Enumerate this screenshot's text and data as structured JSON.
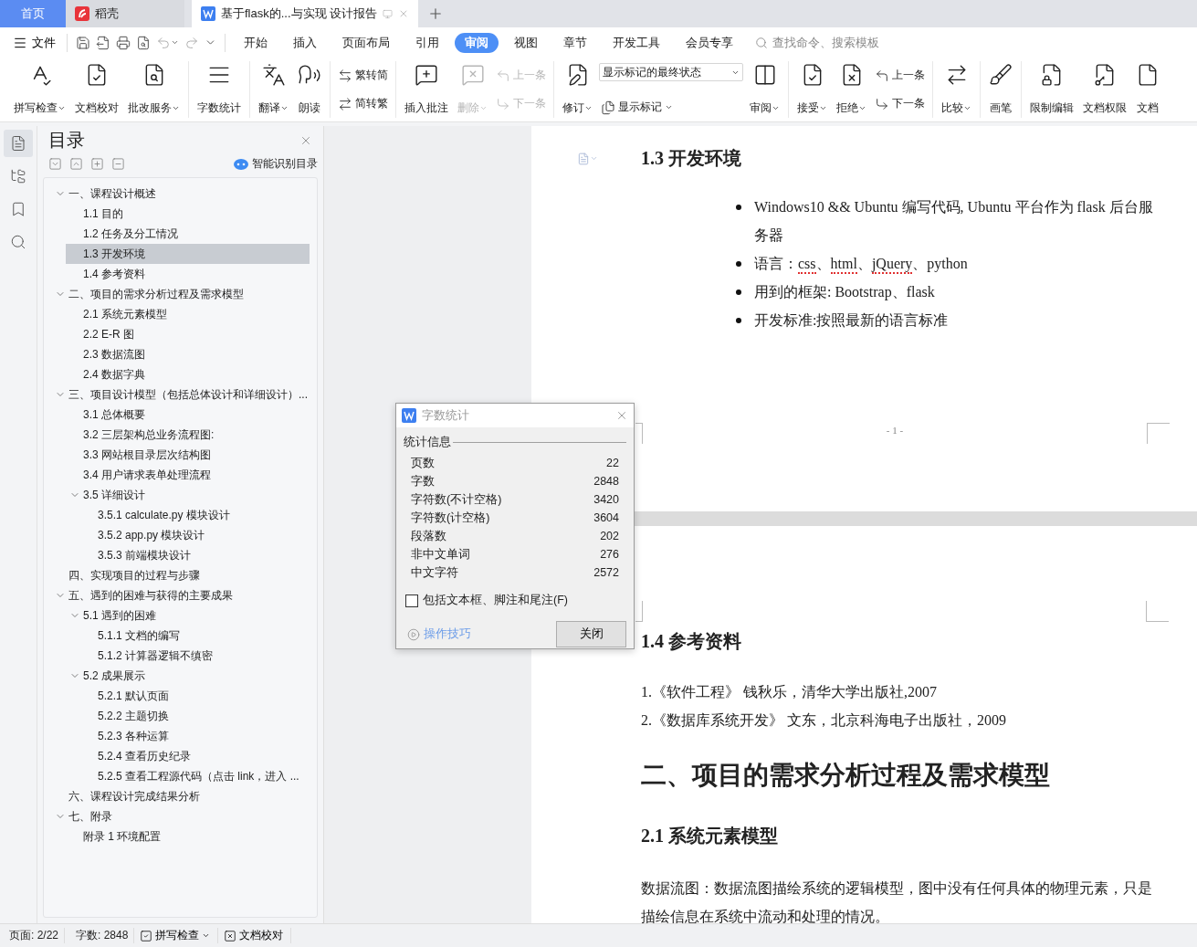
{
  "tabs": [
    {
      "kind": "home",
      "label": "首页",
      "selected": false
    },
    {
      "kind": "docer",
      "label": "稻壳",
      "selected": false
    },
    {
      "kind": "document",
      "label": "基于flask的...与实现 设计报告",
      "selected": true
    }
  ],
  "menu": {
    "file": "文件",
    "items": [
      {
        "label": "开始",
        "selected": false
      },
      {
        "label": "插入",
        "selected": false
      },
      {
        "label": "页面布局",
        "selected": false
      },
      {
        "label": "引用",
        "selected": false
      },
      {
        "label": "审阅",
        "selected": true
      },
      {
        "label": "视图",
        "selected": false
      },
      {
        "label": "章节",
        "selected": false
      },
      {
        "label": "开发工具",
        "selected": false
      },
      {
        "label": "会员专享",
        "selected": false
      }
    ],
    "search": {
      "placeholder": "查找命令、搜索模板"
    }
  },
  "ribbon": [
    {
      "tools": [
        {
          "kind": "large",
          "label": "拼写检查",
          "dropdown": true,
          "disabled": false
        },
        {
          "kind": "large",
          "label": "文档校对",
          "dropdown": false,
          "disabled": false
        },
        {
          "kind": "large",
          "label": "批改服务",
          "dropdown": true,
          "disabled": false
        }
      ]
    },
    {
      "tools": [
        {
          "kind": "large",
          "label": "字数统计",
          "dropdown": false,
          "disabled": false
        }
      ]
    },
    {
      "tools": [
        {
          "kind": "large",
          "label": "翻译",
          "dropdown": true,
          "disabled": false
        },
        {
          "kind": "large",
          "label": "朗读",
          "dropdown": false,
          "disabled": false
        }
      ]
    },
    {
      "tools": [
        {
          "kind": "stack",
          "items": [
            {
              "label": "繁转简",
              "disabled": false
            },
            {
              "label": "简转繁",
              "disabled": false
            }
          ]
        }
      ]
    },
    {
      "tools": [
        {
          "kind": "large",
          "label": "插入批注",
          "dropdown": false,
          "disabled": false
        },
        {
          "kind": "large",
          "label": "删除",
          "dropdown": true,
          "disabled": true
        },
        {
          "kind": "stack",
          "items": [
            {
              "label": "上一条",
              "disabled": true
            },
            {
              "label": "下一条",
              "disabled": true
            }
          ]
        }
      ]
    },
    {
      "tools": [
        {
          "kind": "large",
          "label": "修订",
          "dropdown": true,
          "disabled": false
        },
        {
          "kind": "markup",
          "value": "显示标记的最终状态",
          "option": "显示标记"
        },
        {
          "kind": "large",
          "label": "审阅",
          "dropdown": true,
          "disabled": false
        }
      ]
    },
    {
      "tools": [
        {
          "kind": "large",
          "label": "接受",
          "dropdown": true,
          "disabled": false
        },
        {
          "kind": "large",
          "label": "拒绝",
          "dropdown": true,
          "disabled": false
        },
        {
          "kind": "stack",
          "items": [
            {
              "label": "上一条",
              "disabled": false
            },
            {
              "label": "下一条",
              "disabled": false
            }
          ]
        }
      ]
    },
    {
      "tools": [
        {
          "kind": "large",
          "label": "比较",
          "dropdown": true,
          "disabled": false
        }
      ]
    },
    {
      "tools": [
        {
          "kind": "large",
          "label": "画笔",
          "dropdown": false,
          "disabled": false
        }
      ]
    },
    {
      "tools": [
        {
          "kind": "large",
          "label": "限制编辑",
          "dropdown": false,
          "disabled": false
        },
        {
          "kind": "large",
          "label": "文档权限",
          "dropdown": false,
          "disabled": false
        },
        {
          "kind": "large",
          "label": "文档",
          "dropdown": false,
          "disabled": false
        }
      ]
    }
  ],
  "rail": [
    {
      "selected": true
    },
    {
      "selected": false
    },
    {
      "selected": false
    },
    {
      "selected": false
    }
  ],
  "toc": {
    "title": "目录",
    "smart": "智能识别目录",
    "items": [
      {
        "label": "一、课程设计概述",
        "selected": false,
        "expanded": true,
        "children": [
          {
            "label": "1.1 目的",
            "selected": false
          },
          {
            "label": "1.2  任务及分工情况",
            "selected": false
          },
          {
            "label": "1.3 开发环境",
            "selected": true
          },
          {
            "label": "1.4  参考资料",
            "selected": false
          }
        ]
      },
      {
        "label": "二、项目的需求分析过程及需求模型",
        "selected": false,
        "expanded": true,
        "children": [
          {
            "label": "2.1 系统元素模型",
            "selected": false
          },
          {
            "label": "2.2 E-R 图",
            "selected": false
          },
          {
            "label": "2.3 数据流图",
            "selected": false
          },
          {
            "label": "2.4 数据字典",
            "selected": false
          }
        ]
      },
      {
        "label": "三、项目设计模型（包括总体设计和详细设计）...",
        "selected": false,
        "expanded": true,
        "children": [
          {
            "label": "3.1 总体概要",
            "selected": false
          },
          {
            "label": "3.2  三层架构总业务流程图:",
            "selected": false
          },
          {
            "label": "3.3  网站根目录层次结构图",
            "selected": false
          },
          {
            "label": "3.4  用户请求表单处理流程",
            "selected": false
          },
          {
            "label": "3.5  详细设计",
            "selected": false,
            "expanded": true,
            "children": [
              {
                "label": "3.5.1 calculate.py 模块设计",
                "selected": false
              },
              {
                "label": "3.5.2 app.py 模块设计",
                "selected": false
              },
              {
                "label": "3.5.3 前端模块设计",
                "selected": false
              }
            ]
          }
        ]
      },
      {
        "label": "四、实现项目的过程与步骤",
        "selected": false
      },
      {
        "label": "五、遇到的困难与获得的主要成果",
        "selected": false,
        "expanded": true,
        "children": [
          {
            "label": "5.1 遇到的困难",
            "selected": false,
            "expanded": true,
            "children": [
              {
                "label": "5.1.1  文档的编写",
                "selected": false
              },
              {
                "label": "5.1.2  计算器逻辑不缜密",
                "selected": false
              }
            ]
          },
          {
            "label": "5.2  成果展示",
            "selected": false,
            "expanded": true,
            "children": [
              {
                "label": "5.2.1 默认页面",
                "selected": false
              },
              {
                "label": "5.2.2 主题切换",
                "selected": false
              },
              {
                "label": "5.2.3  各种运算",
                "selected": false
              },
              {
                "label": "5.2.4 查看历史纪录",
                "selected": false
              },
              {
                "label": "5.2.5 查看工程源代码（点击 link，进入 ...",
                "selected": false
              }
            ]
          }
        ]
      },
      {
        "label": "六、课程设计完成结果分析",
        "selected": false
      },
      {
        "label": "七、附录",
        "selected": false,
        "expanded": true,
        "children": [
          {
            "label": "附录 1 环境配置",
            "selected": false
          }
        ]
      }
    ]
  },
  "page1": {
    "heading": "1.3 开发环境",
    "bullets": [
      {
        "segments": [
          {
            "text": "Windows10 && Ubuntu 编写代码, Ubuntu 平台作为 flask 后台服务器",
            "misspelled": false
          }
        ]
      },
      {
        "segments": [
          {
            "text": "语言：",
            "misspelled": false
          },
          {
            "text": "css",
            "misspelled": true
          },
          {
            "text": "、",
            "misspelled": false
          },
          {
            "text": "html",
            "misspelled": true
          },
          {
            "text": "、",
            "misspelled": false
          },
          {
            "text": "jQuery",
            "misspelled": true
          },
          {
            "text": "、python",
            "misspelled": false
          }
        ]
      },
      {
        "segments": [
          {
            "text": "用到的框架: Bootstrap、flask",
            "misspelled": false
          }
        ]
      },
      {
        "segments": [
          {
            "text": "开发标准:按照最新的语言标准",
            "misspelled": false
          }
        ]
      }
    ],
    "page_number": "- 1 -"
  },
  "page2": {
    "heading": "1.4  参考资料",
    "references": [
      "1.《软件工程》 钱秋乐，清华大学出版社,2007",
      "2.《数据库系统开发》 文东，北京科海电子出版社，2009"
    ],
    "chapter_heading": "二、项目的需求分析过程及需求模型",
    "section_heading": "2.1 系统元素模型",
    "paragraph": "数据流图：数据流图描绘系统的逻辑模型，图中没有任何具体的物理元素，只是描绘信息在系统中流动和处理的情况。"
  },
  "dialog": {
    "title": "字数统计",
    "section": "统计信息",
    "rows": [
      {
        "label": "页数",
        "value": "22"
      },
      {
        "label": "字数",
        "value": "2848"
      },
      {
        "label": "字符数(不计空格)",
        "value": "3420"
      },
      {
        "label": "字符数(计空格)",
        "value": "3604"
      },
      {
        "label": "段落数",
        "value": "202"
      },
      {
        "label": "非中文单词",
        "value": "276"
      },
      {
        "label": "中文字符",
        "value": "2572"
      }
    ],
    "checkbox": {
      "label": "包括文本框、脚注和尾注(F)",
      "checked": false
    },
    "tips": "操作技巧",
    "close": "关闭"
  },
  "status_bar": {
    "page": "页面: 2/22",
    "words": "字数: 2848",
    "spell": {
      "label": "拼写检查",
      "dropdown": true
    },
    "proof": "文档校对"
  }
}
